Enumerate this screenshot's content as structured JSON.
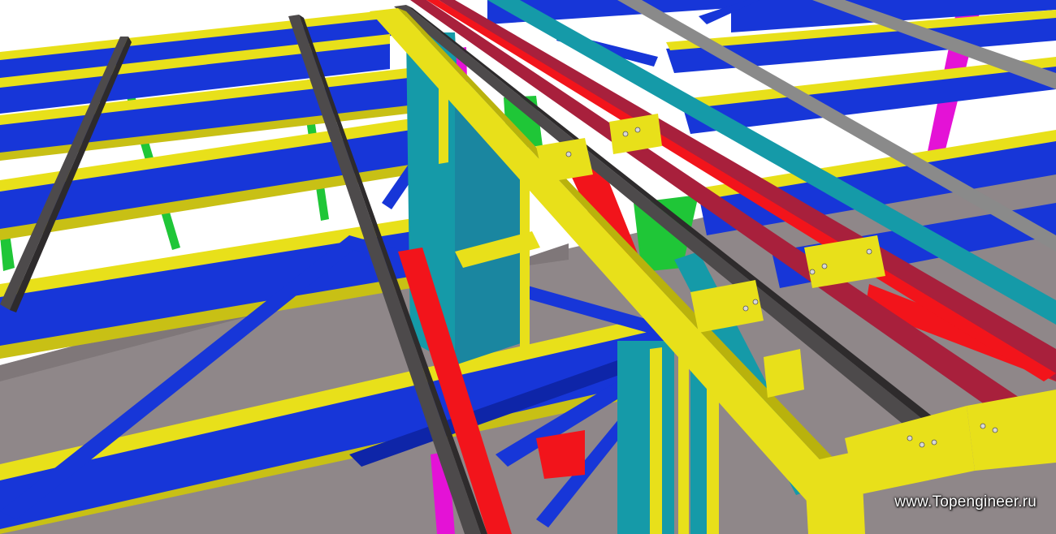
{
  "image": {
    "subject": "steel-frame-3d-model",
    "watermark_text": "www.Topengineer.ru"
  },
  "colors": {
    "background": "#ffffff",
    "floor": "#8f8789",
    "floor_dark": "#7f7779",
    "deck_beam": "#1736d8",
    "deck_beam_dark": "#0e25a8",
    "flange_yellow": "#e8e01a",
    "flange_yellow_dark": "#b9b20c",
    "rail_grey": "#4d4a4b",
    "rail_grey_dark": "#2e2b2c",
    "rail_light_grey": "#8a8a8a",
    "red": "#f2141b",
    "maroon": "#a8203c",
    "teal": "#159aa8",
    "green": "#1fc637",
    "magenta": "#e412d6"
  }
}
